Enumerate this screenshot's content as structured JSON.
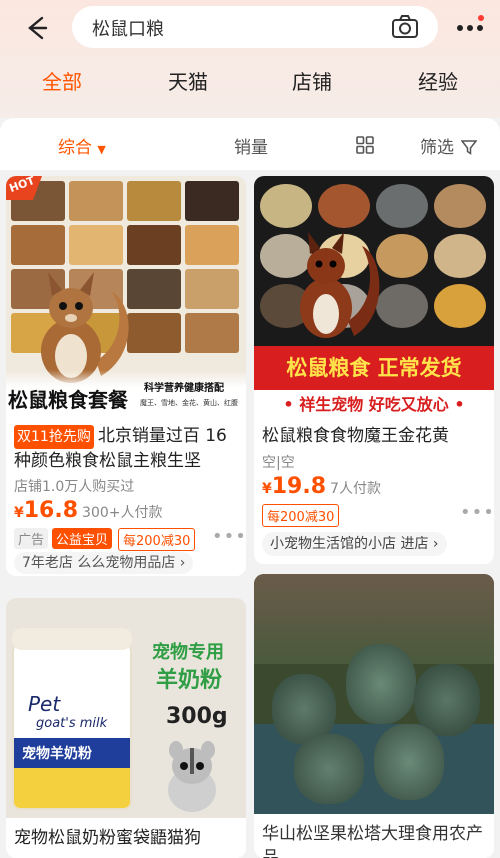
{
  "search": {
    "query": "松鼠口粮"
  },
  "tabs": [
    "全部",
    "天猫",
    "店铺",
    "经验"
  ],
  "filters": {
    "sort": "综合",
    "sales": "销量",
    "filter": "筛选"
  },
  "products": [
    {
      "img_text": {
        "hot": "HOT",
        "big": "松鼠粮食套餐",
        "small1": "科学营养健康搭配",
        "small2": "魔王、雪地、金花、黄山、红腹"
      },
      "badge": "双11抢先购",
      "title": "北京销量过百 16种颜色粮食松鼠主粮生坚",
      "sub": "店铺1.0万人购买过",
      "price_sym": "¥",
      "price": "16.8",
      "sold": "300+人付款",
      "tags": [
        "广告",
        "公益宝贝",
        "每200减30"
      ],
      "shop": "7年老店 么么宠物用品店 ›"
    },
    {
      "img_text": {
        "banner": "松鼠粮食 正常发货",
        "slogan": "• 祥生宠物 好吃又放心 •"
      },
      "title": "松鼠粮食食物魔王金花黄",
      "sub": "空|空",
      "price_sym": "¥",
      "price": "19.8",
      "sold": "7人付款",
      "tags": [
        "每200减30"
      ],
      "shop": "小宠物生活馆的小店 进店 ›"
    },
    {
      "img_text": {
        "pet": "Pet",
        "goat": "goat's milk",
        "cn": "宠物羊奶粉",
        "big1": "宠物专用",
        "big2": "羊奶粉",
        "weight": "300g"
      },
      "title": "宠物松鼠奶粉蜜袋鼯猫狗"
    },
    {
      "title": "华山松坚果松塔大理食用农产品"
    }
  ],
  "colors": {
    "accent": "#ff5500",
    "price": "#ff5000",
    "red_banner": "#d81e1e"
  }
}
